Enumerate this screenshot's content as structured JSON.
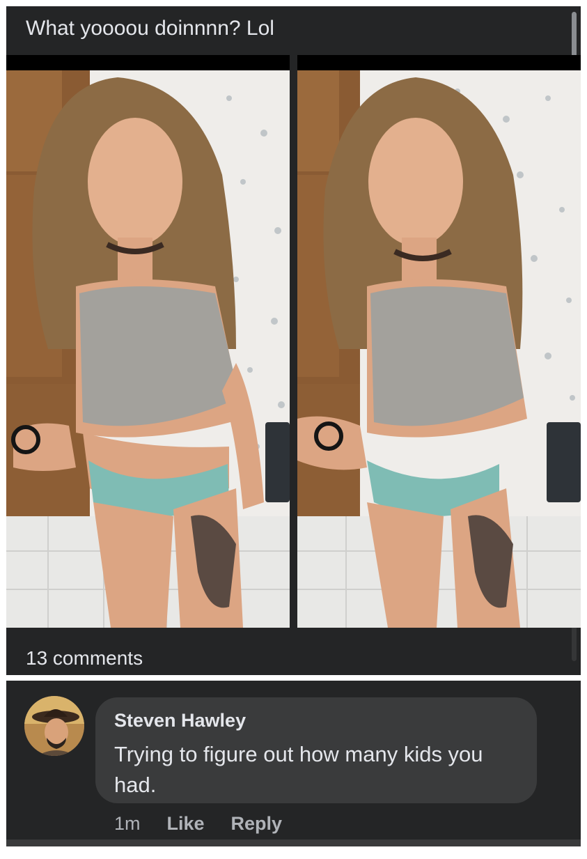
{
  "post": {
    "text": "What yoooou doinnnn? Lol",
    "comments_count": "13 comments"
  },
  "comment": {
    "author": "Steven Hawley",
    "text": "Trying to figure out how many kids you had.",
    "time": "1m",
    "like_label": "Like",
    "reply_label": "Reply"
  },
  "colors": {
    "panel_bg": "#242526",
    "bubble_bg": "#3a3b3c",
    "primary_text": "#e4e6eb",
    "secondary_text": "#b0b3b8"
  }
}
